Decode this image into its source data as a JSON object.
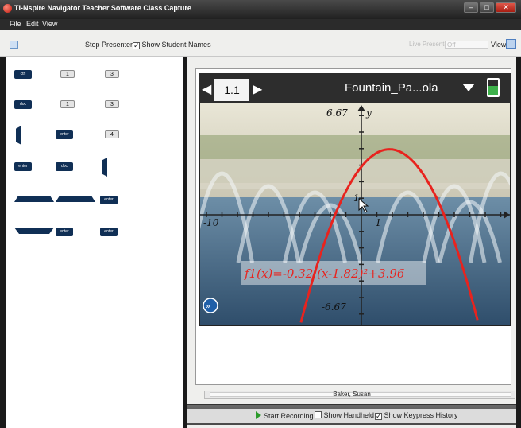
{
  "window": {
    "title": "TI-Nspire Navigator Teacher Software Class Capture",
    "buttons": [
      "–",
      "□",
      "✕"
    ]
  },
  "menu": [
    "File",
    "Edit",
    "View"
  ],
  "toolbar": {
    "stop_presenter": "Stop Presenter",
    "show_student_names": "Show Student Names",
    "show_student_names_checked": true,
    "disabled_label": "Live Presenter",
    "disabled_value": "Off",
    "view_label": "View"
  },
  "keypress_history": [
    {
      "label": "ctrl",
      "style": "dark"
    },
    {
      "label": "1",
      "style": "light"
    },
    {
      "label": "3",
      "style": "light"
    },
    {
      "label": "doc",
      "style": "dark"
    },
    {
      "label": "1",
      "style": "light"
    },
    {
      "label": "3",
      "style": "light"
    },
    {
      "label": "",
      "style": "tall"
    },
    {
      "label": "enter",
      "style": "dark"
    },
    {
      "label": "4",
      "style": "light"
    },
    {
      "label": "enter",
      "style": "dark"
    },
    {
      "label": "doc",
      "style": "dark"
    },
    {
      "label": "",
      "style": "tall"
    },
    {
      "label": "",
      "style": "trap"
    },
    {
      "label": "",
      "style": "trap"
    },
    {
      "label": "enter",
      "style": "dark"
    },
    {
      "label": "",
      "style": "trap2"
    },
    {
      "label": "enter",
      "style": "dark"
    },
    {
      "label": "enter",
      "style": "dark"
    }
  ],
  "handheld": {
    "page_tab": "1.1",
    "doc_title": "Fountain_Pa...ola",
    "axis_labels": {
      "ymax": "6.67",
      "ymin": "-6.67",
      "xmin": "-10",
      "x1": "1",
      "y1": "1",
      "yname": "y"
    },
    "function_label": "f1(x)=-0.32·(x-1.82)²+3.96",
    "colors": {
      "curve": "#e8231e",
      "axis": "#222222"
    }
  },
  "chart_data": {
    "type": "line",
    "series": [
      {
        "function": "-0.32*(x-1.82)^2+3.96"
      }
    ],
    "xlim": [
      -10,
      10
    ],
    "ylim": [
      -6.67,
      6.67
    ]
  },
  "student_name": "Baker, Susan",
  "bottombar": {
    "start_recording": "Start Recording",
    "show_handheld": "Show Handheld",
    "show_handheld_checked": false,
    "show_keypress_history": "Show Keypress History",
    "show_keypress_history_checked": true
  }
}
